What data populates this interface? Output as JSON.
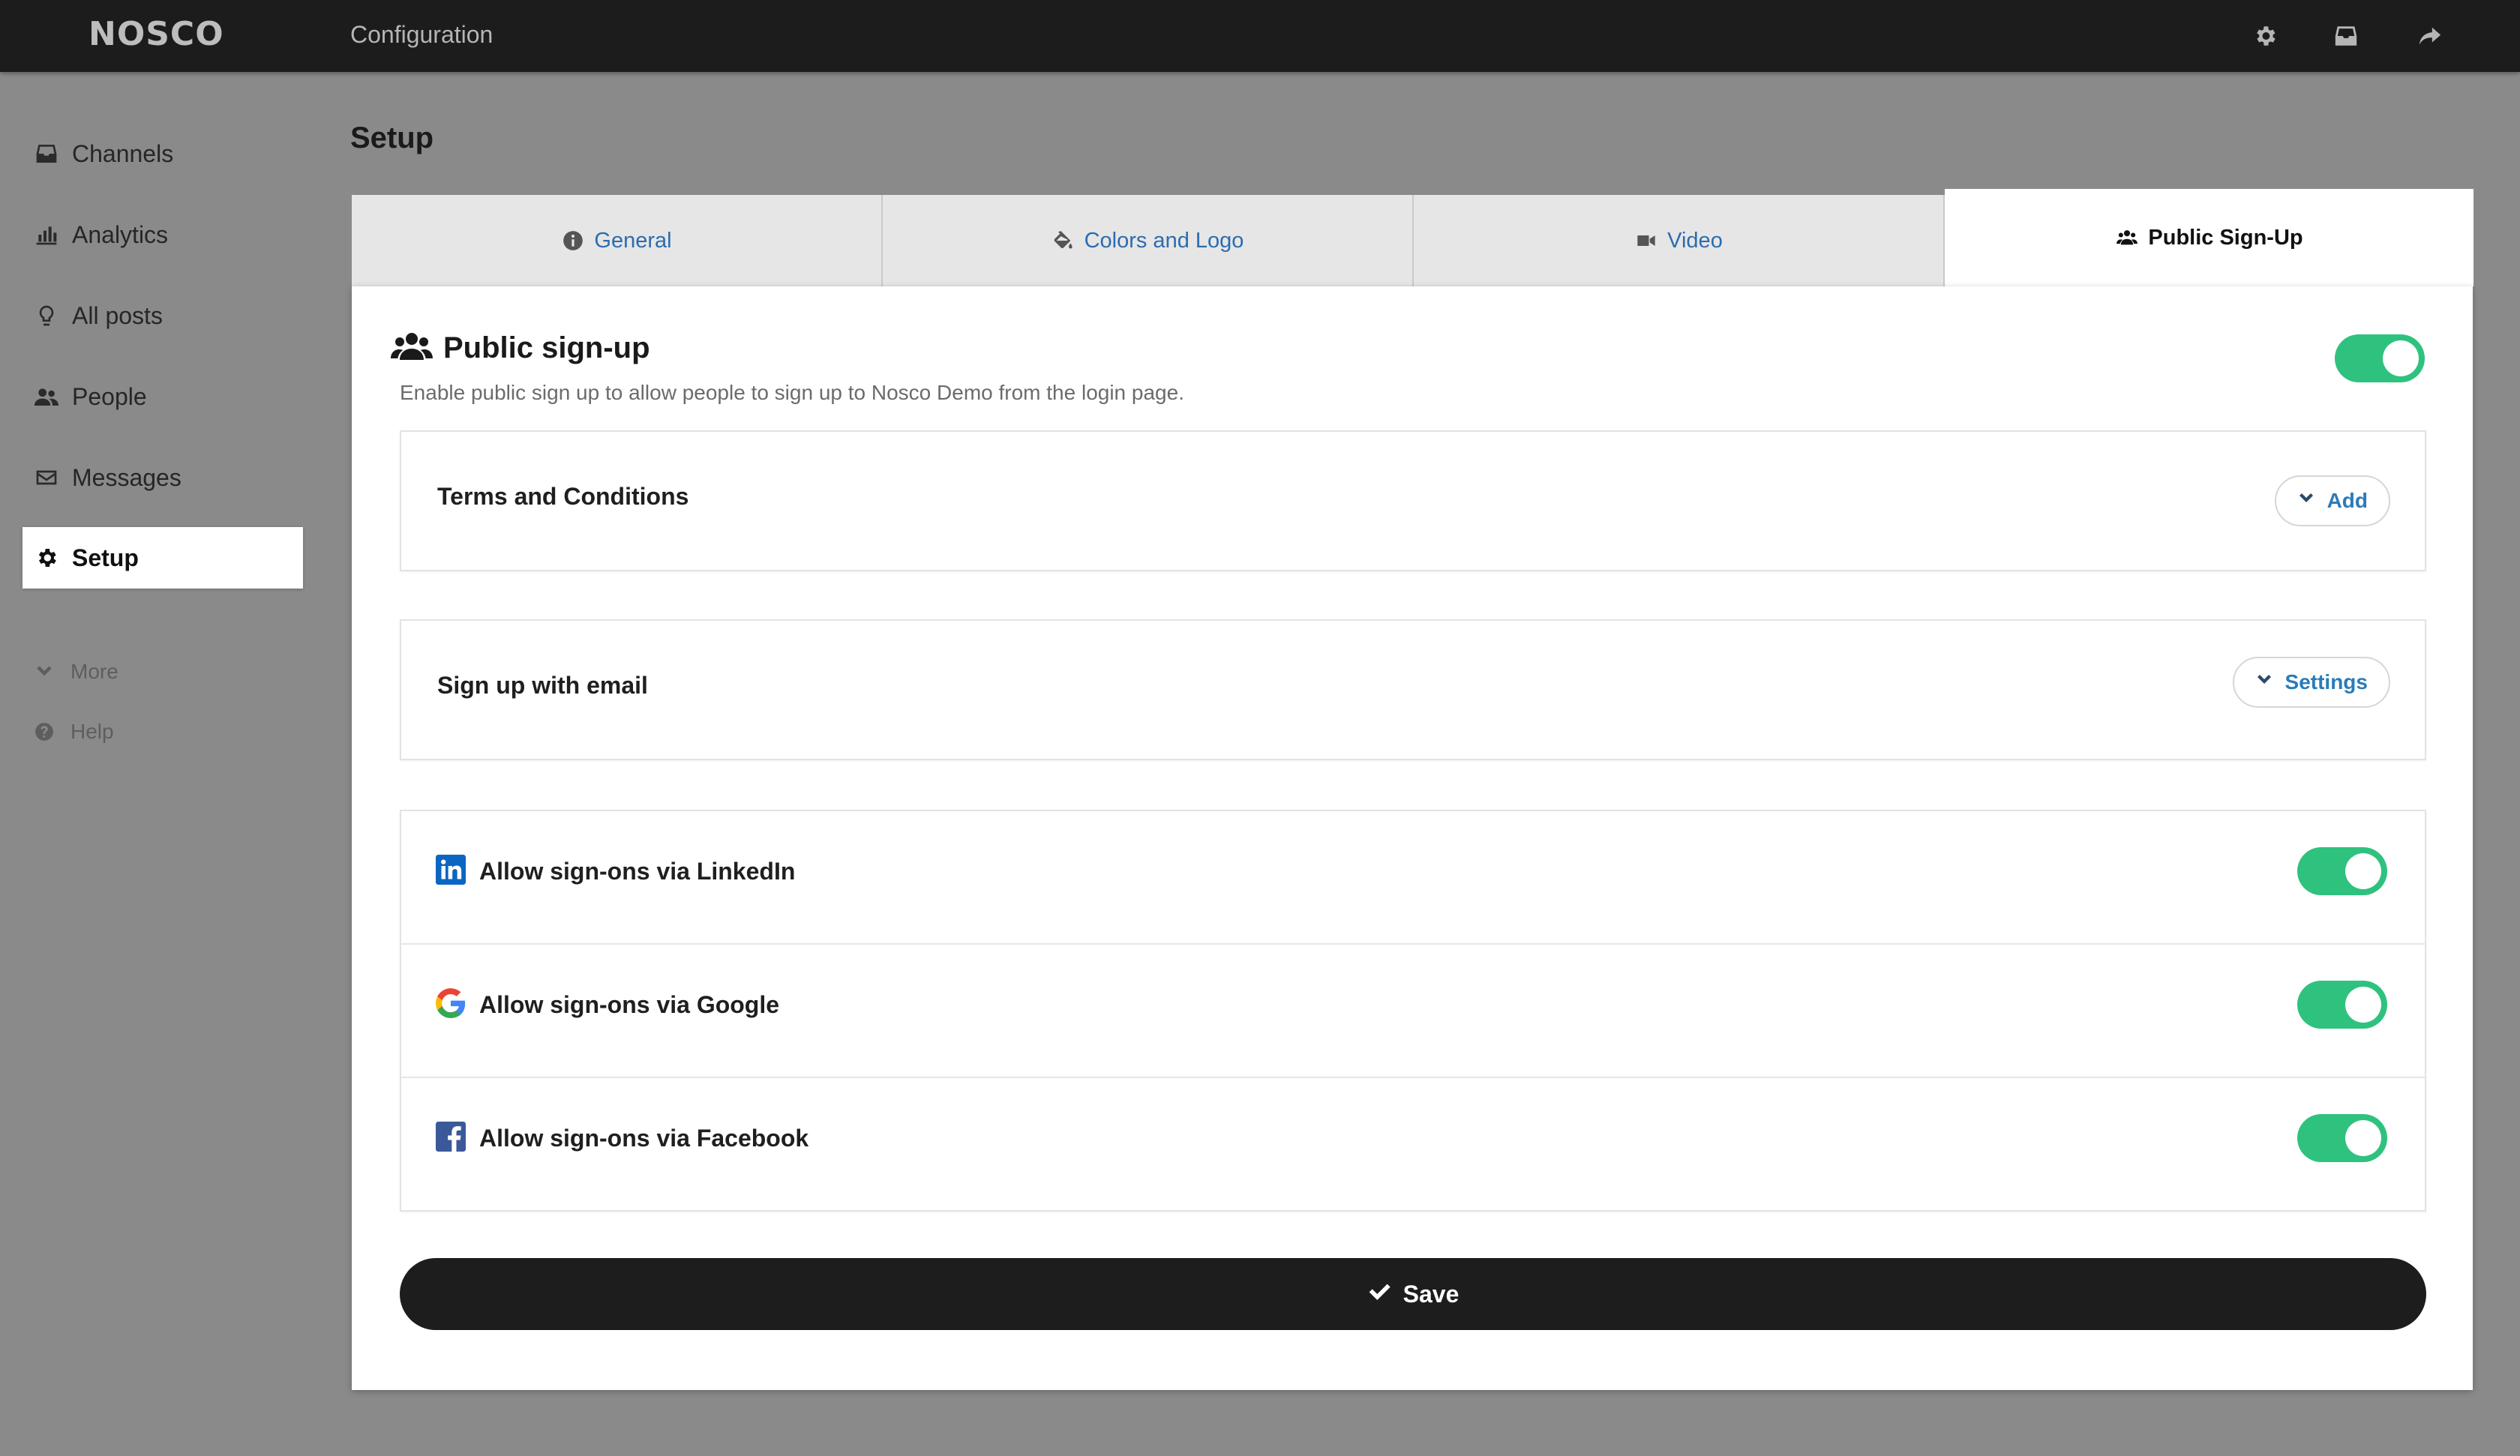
{
  "app": {
    "logo": "NOSCO",
    "section": "Configuration"
  },
  "topbar_icons": [
    "gear-icon",
    "inbox-icon",
    "share-arrow-icon"
  ],
  "sidebar": {
    "items": [
      {
        "label": "Channels",
        "icon": "inbox-icon"
      },
      {
        "label": "Analytics",
        "icon": "bar-chart-icon"
      },
      {
        "label": "All posts",
        "icon": "lightbulb-icon"
      },
      {
        "label": "People",
        "icon": "users-icon"
      },
      {
        "label": "Messages",
        "icon": "envelope-icon"
      },
      {
        "label": "Setup",
        "icon": "gear-icon",
        "active": true
      }
    ],
    "more": "More",
    "help": "Help"
  },
  "page": {
    "title": "Setup"
  },
  "tabs": [
    {
      "label": "General",
      "icon": "info-circle-icon"
    },
    {
      "label": "Colors and Logo",
      "icon": "paint-bucket-icon"
    },
    {
      "label": "Video",
      "icon": "video-camera-icon"
    },
    {
      "label": "Public Sign-Up",
      "icon": "users-icon",
      "active": true
    }
  ],
  "public_signup": {
    "title": "Public sign-up",
    "description": "Enable public sign up to allow people to sign up to Nosco Demo from the login page.",
    "enabled": true
  },
  "terms": {
    "label": "Terms and Conditions",
    "button": "Add"
  },
  "email_signup": {
    "label": "Sign up with email",
    "button": "Settings"
  },
  "providers": [
    {
      "label": "Allow sign-ons via LinkedIn",
      "icon": "linkedin-icon",
      "enabled": true
    },
    {
      "label": "Allow sign-ons via Google",
      "icon": "google-icon",
      "enabled": true
    },
    {
      "label": "Allow sign-ons via Facebook",
      "icon": "facebook-icon",
      "enabled": true
    }
  ],
  "save": {
    "label": "Save"
  },
  "colors": {
    "toggle_on": "#2ec27e",
    "link": "#2b7bb9",
    "topbar": "#1c1c1c",
    "save_button": "#1d1d1d"
  }
}
